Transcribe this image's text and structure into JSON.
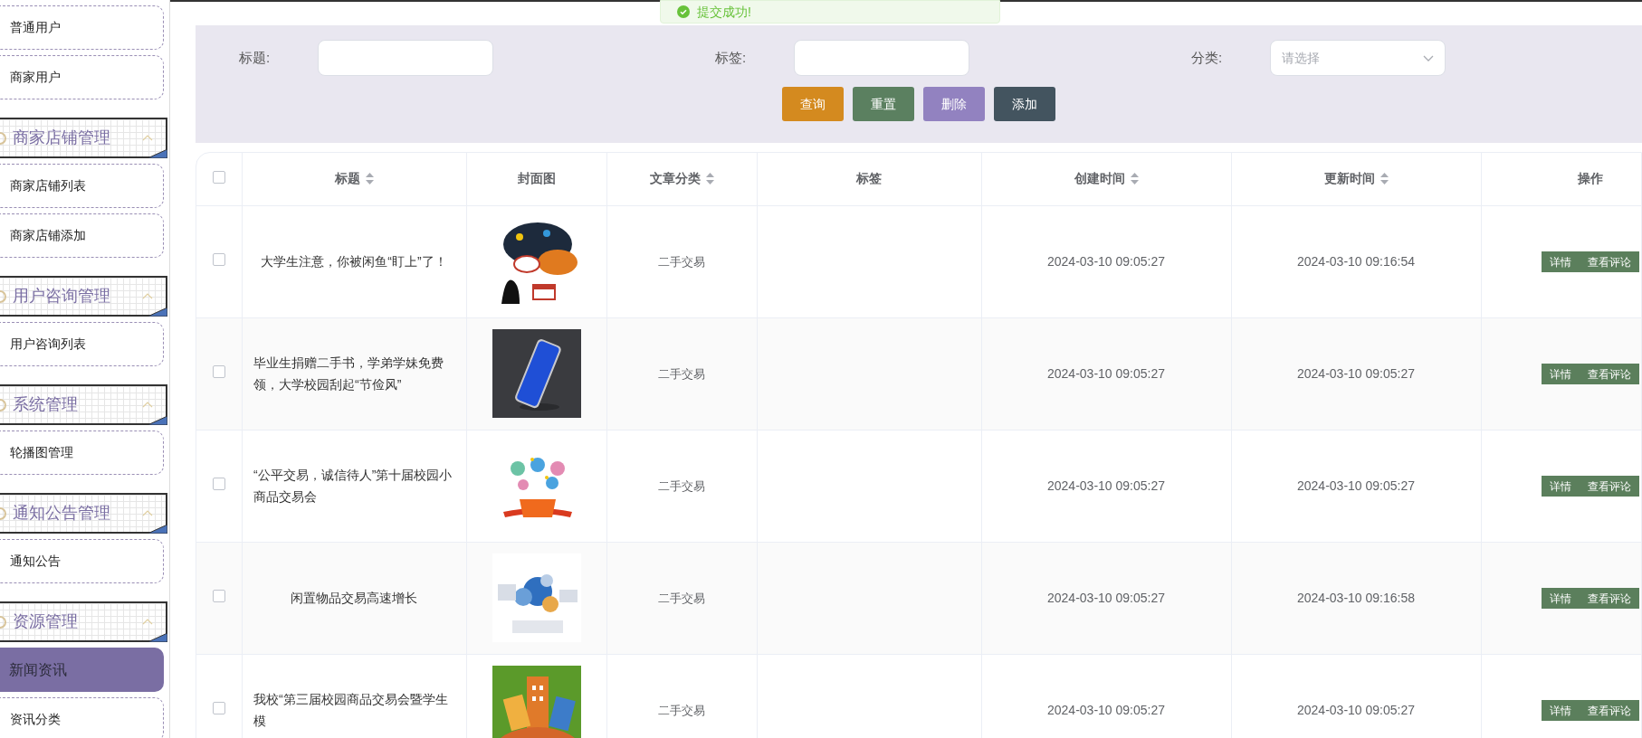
{
  "toast": {
    "text": "提交成功!"
  },
  "sidebar": {
    "items": [
      {
        "kind": "item",
        "label": "普通用户",
        "selected": false
      },
      {
        "kind": "item",
        "label": "商家用户",
        "selected": false
      },
      {
        "kind": "group",
        "label": "商家店铺管理",
        "expanded": true
      },
      {
        "kind": "item",
        "label": "商家店铺列表",
        "selected": false
      },
      {
        "kind": "item",
        "label": "商家店铺添加",
        "selected": false
      },
      {
        "kind": "group",
        "label": "用户咨询管理",
        "expanded": true
      },
      {
        "kind": "item",
        "label": "用户咨询列表",
        "selected": false
      },
      {
        "kind": "group",
        "label": "系统管理",
        "expanded": true
      },
      {
        "kind": "item",
        "label": "轮播图管理",
        "selected": false
      },
      {
        "kind": "group",
        "label": "通知公告管理",
        "expanded": true
      },
      {
        "kind": "item",
        "label": "通知公告",
        "selected": false
      },
      {
        "kind": "group",
        "label": "资源管理",
        "expanded": true
      },
      {
        "kind": "item",
        "label": "新闻资讯",
        "selected": true
      },
      {
        "kind": "item",
        "label": "资讯分类",
        "selected": false
      }
    ]
  },
  "search": {
    "fields": [
      {
        "kind": "input",
        "label": "标题:"
      },
      {
        "kind": "input",
        "label": "标签:"
      },
      {
        "kind": "select",
        "label": "分类:",
        "placeholder": "请选择"
      }
    ],
    "buttons": [
      {
        "kind": "query",
        "label": "查询"
      },
      {
        "kind": "reset",
        "label": "重置"
      },
      {
        "kind": "delete",
        "label": "删除"
      },
      {
        "kind": "add",
        "label": "添加"
      }
    ]
  },
  "table": {
    "select_all": {
      "checked": false
    },
    "columns": [
      {
        "label": "标题",
        "sortable": true
      },
      {
        "label": "封面图",
        "sortable": false
      },
      {
        "label": "文章分类",
        "sortable": true
      },
      {
        "label": "标签",
        "sortable": false
      },
      {
        "label": "创建时间",
        "sortable": true
      },
      {
        "label": "更新时间",
        "sortable": true
      },
      {
        "label": "操作",
        "sortable": false
      }
    ],
    "rows": [
      {
        "checked": false,
        "title": "大学生注意，你被闲鱼“盯上”了！",
        "cover": {
          "kind": "picture"
        },
        "category": "二手交易",
        "created": "2024-03-10 09:05:27",
        "updated": "2024-03-10 09:16:54",
        "actions": [
          "详情",
          "查看评论"
        ]
      },
      {
        "checked": false,
        "title": "毕业生捐赠二手书，学弟学妹免费领，大学校园刮起“节俭风”",
        "cover": {
          "kind": "picture"
        },
        "category": "二手交易",
        "created": "2024-03-10 09:05:27",
        "updated": "2024-03-10 09:05:27",
        "actions": [
          "详情",
          "查看评论"
        ]
      },
      {
        "checked": false,
        "title": "“公平交易，诚信待人”第十届校园小商品交易会",
        "cover": {
          "kind": "picture"
        },
        "category": "二手交易",
        "created": "2024-03-10 09:05:27",
        "updated": "2024-03-10 09:05:27",
        "actions": [
          "详情",
          "查看评论"
        ]
      },
      {
        "checked": false,
        "title": "闲置物品交易高速增长",
        "cover": {
          "kind": "picture"
        },
        "category": "二手交易",
        "created": "2024-03-10 09:05:27",
        "updated": "2024-03-10 09:16:58",
        "actions": [
          "详情",
          "查看评论"
        ]
      },
      {
        "checked": false,
        "title": "我校“第三届校园商品交易会暨学生模",
        "cover": {
          "kind": "picture"
        },
        "category": "二手交易",
        "created": "2024-03-10 09:05:27",
        "updated": "2024-03-10 09:05:27",
        "actions": [
          "详情",
          "查看评论"
        ]
      }
    ]
  }
}
